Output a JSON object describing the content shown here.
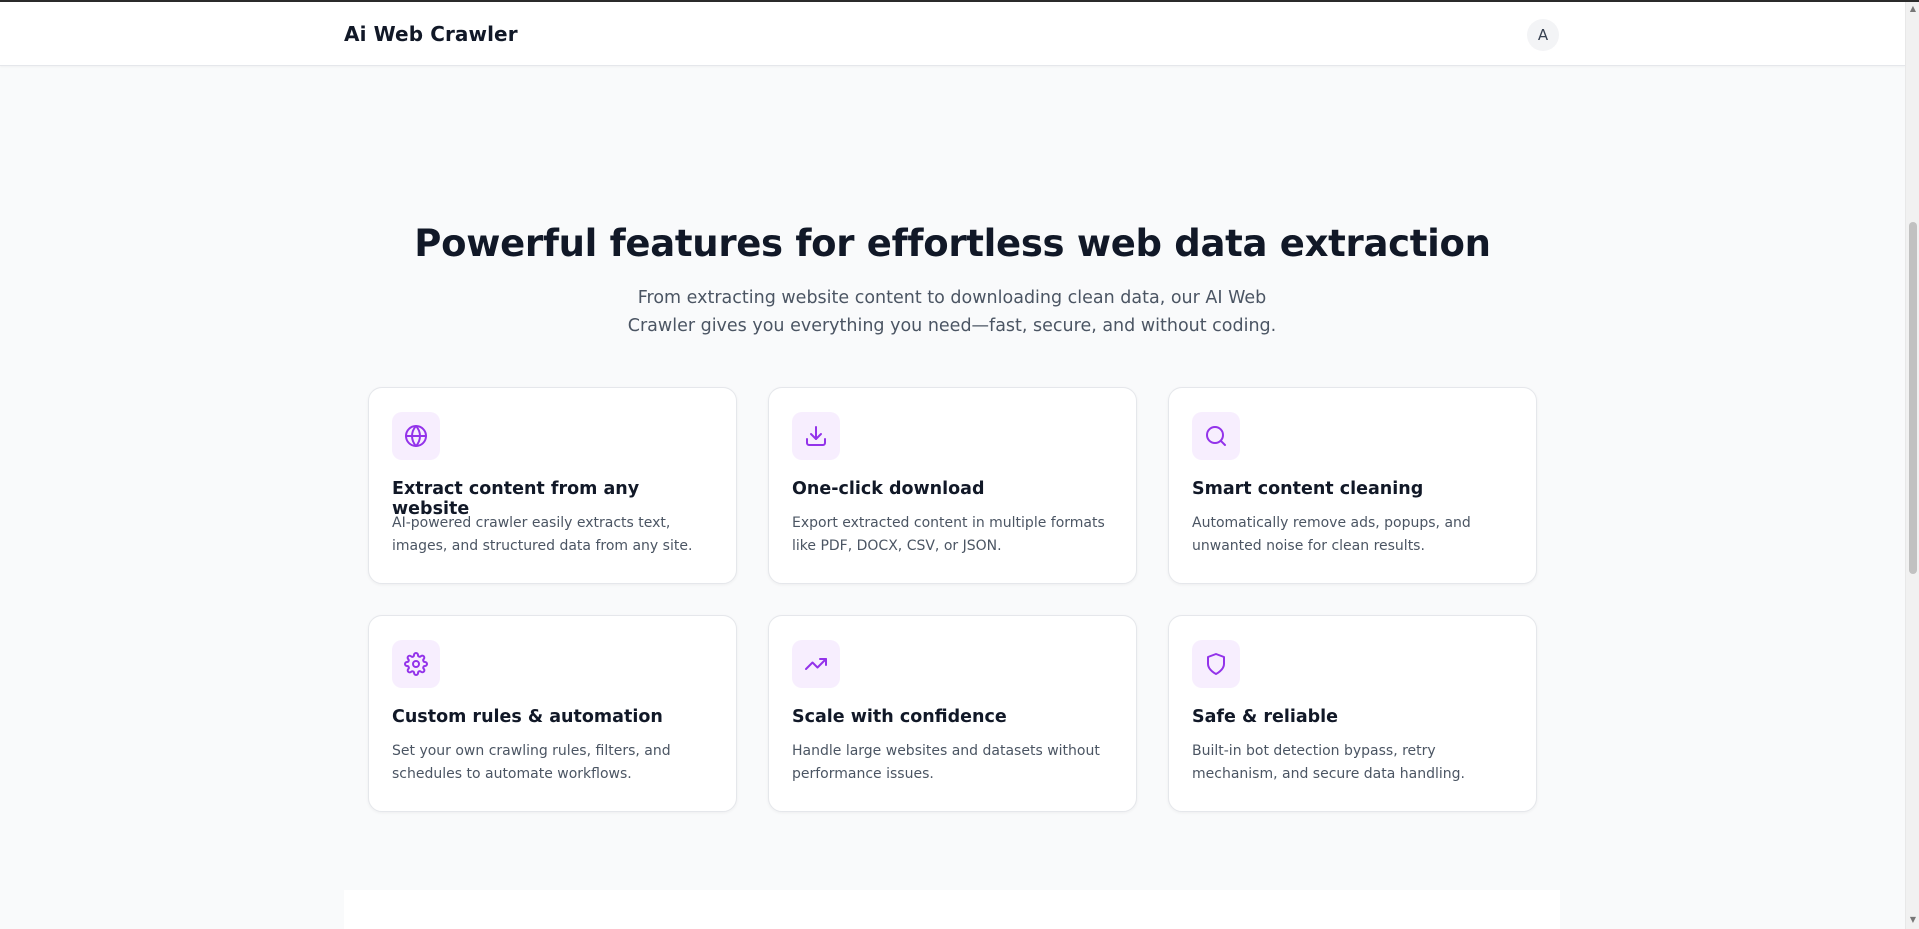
{
  "header": {
    "brand": "Ai Web Crawler",
    "avatar_initial": "A"
  },
  "features": {
    "title": "Powerful features for effortless web data extraction",
    "subtitle": "From extracting website content to downloading clean data, our AI Web Crawler gives you everything you need—fast, secure, and without coding.",
    "cards": [
      {
        "icon": "globe-icon",
        "title": "Extract content from any website",
        "desc": "AI-powered crawler easily extracts text, images, and structured data from any site."
      },
      {
        "icon": "download-icon",
        "title": "One-click download",
        "desc": "Export extracted content in multiple formats like PDF, DOCX, CSV, or JSON."
      },
      {
        "icon": "search-icon",
        "title": "Smart content cleaning",
        "desc": "Automatically remove ads, popups, and unwanted noise for clean results."
      },
      {
        "icon": "gear-icon",
        "title": "Custom rules & automation",
        "desc": "Set your own crawling rules, filters, and schedules to automate workflows."
      },
      {
        "icon": "trending-up-icon",
        "title": "Scale with confidence",
        "desc": "Handle large websites and datasets without performance issues."
      },
      {
        "icon": "shield-icon",
        "title": "Safe & reliable",
        "desc": "Built-in bot detection bypass, retry mechanism, and secure data handling."
      }
    ]
  },
  "colors": {
    "accent": "#9333ea",
    "icon_bg": "#f7eefe",
    "page_bg": "#f9fafb"
  }
}
